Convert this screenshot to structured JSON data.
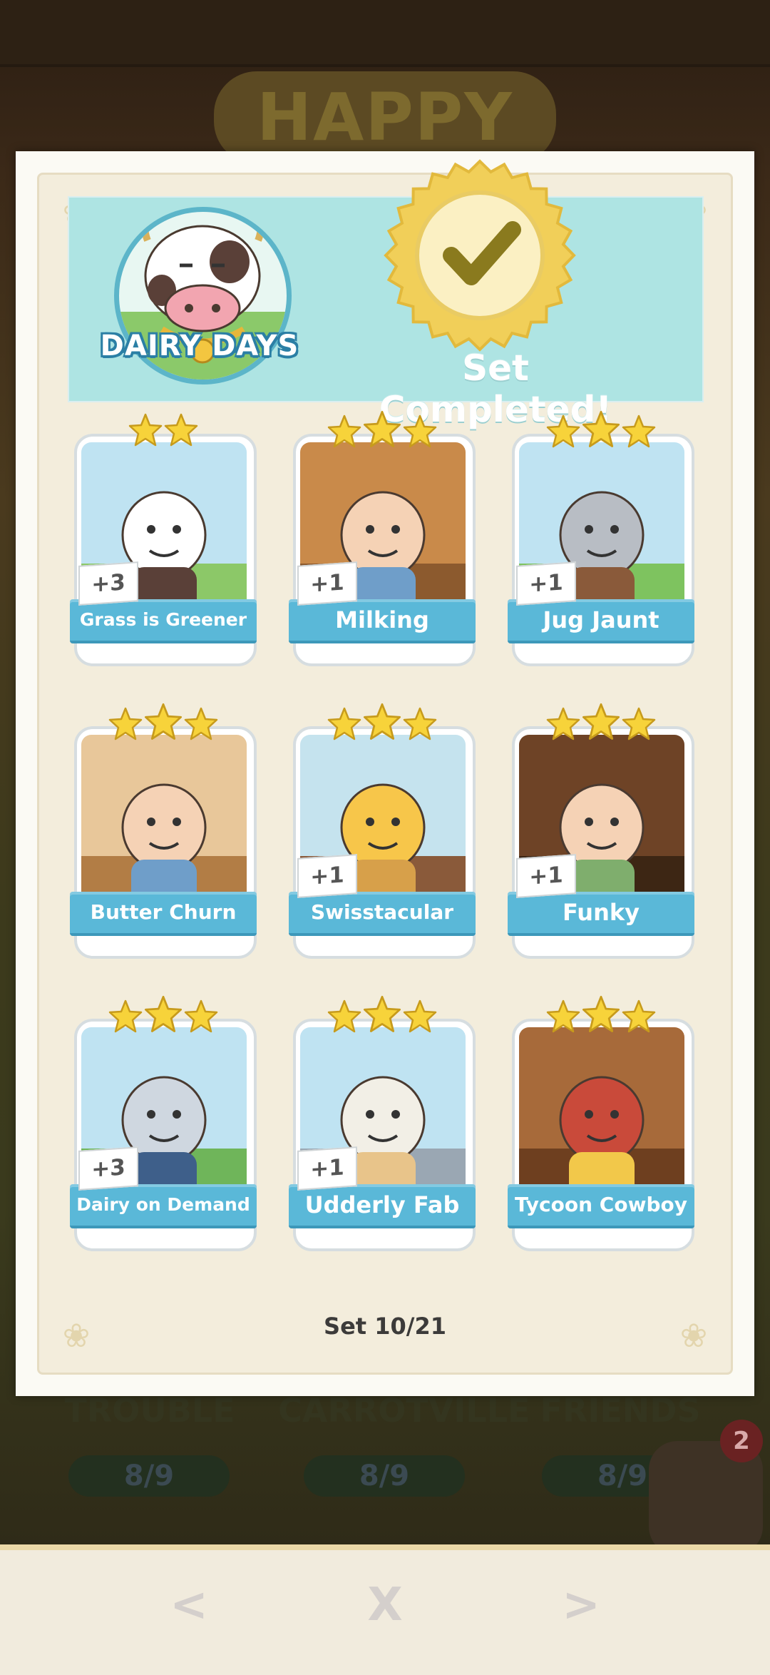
{
  "background": {
    "event_title": "HAPPY HARVEST",
    "sets": [
      {
        "label": "TROUBLE",
        "progress": "8/9"
      },
      {
        "label": "CARROTVILLE",
        "progress": "8/9"
      },
      {
        "label": "FRIENDS",
        "progress": "8/9"
      }
    ],
    "album_badge": "2"
  },
  "modal": {
    "set_name": "DAIRY DAYS",
    "status": "Set Completed!",
    "counter": "Set 10/21",
    "cards": [
      {
        "name": "Grass is Greener",
        "stars": 2,
        "count": "+3"
      },
      {
        "name": "Milking",
        "stars": 3,
        "count": "+1"
      },
      {
        "name": "Jug Jaunt",
        "stars": 3,
        "count": "+1"
      },
      {
        "name": "Butter Churn",
        "stars": 3,
        "count": ""
      },
      {
        "name": "Swisstacular",
        "stars": 3,
        "count": "+1"
      },
      {
        "name": "Funky",
        "stars": 3,
        "count": "+1"
      },
      {
        "name": "Dairy on Demand",
        "stars": 3,
        "count": "+3"
      },
      {
        "name": "Udderly Fab",
        "stars": 3,
        "count": "+1"
      },
      {
        "name": "Tycoon Cowboy",
        "stars": 3,
        "count": ""
      }
    ]
  },
  "nav": {
    "prev": "<",
    "close": "X",
    "next": ">"
  },
  "colors": {
    "ribbon": "#5ab8d8",
    "header": "#aee4e3",
    "seal_gold": "#f1cf59",
    "star": "#f7d33a"
  }
}
